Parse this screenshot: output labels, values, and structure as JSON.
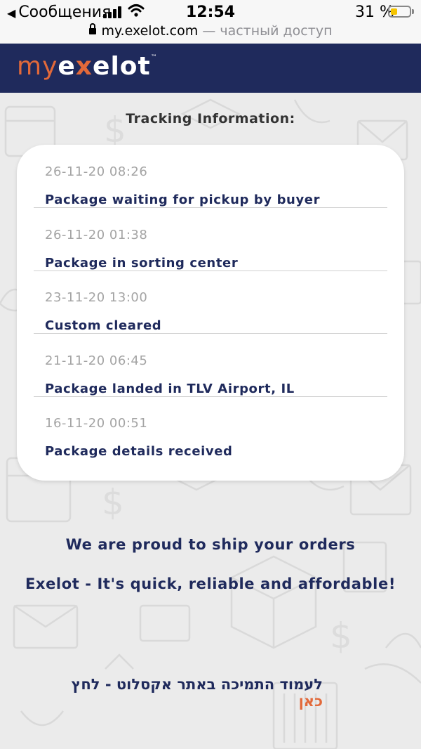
{
  "status_bar": {
    "back_label": "Сообщения",
    "time": "12:54",
    "battery": "31 %",
    "battery_level": 0.31
  },
  "url_bar": {
    "domain": "my.exelot.com",
    "suffix": "— частный доступ"
  },
  "header": {
    "logo": {
      "my": "my",
      "e": "e",
      "x": "x",
      "elot": "elot",
      "tm": "™"
    }
  },
  "tracking": {
    "title": "Tracking Information:",
    "events": [
      {
        "date": "26-11-20 08:26",
        "status": "Package waiting for pickup by buyer"
      },
      {
        "date": "26-11-20 01:38",
        "status": "Package in sorting center"
      },
      {
        "date": "23-11-20 13:00",
        "status": "Custom cleared"
      },
      {
        "date": "21-11-20 06:45",
        "status": "Package landed in TLV Airport, IL"
      },
      {
        "date": "16-11-20 00:51",
        "status": "Package details received"
      }
    ]
  },
  "promo": {
    "line1": "We are proud to ship your orders",
    "line2": "Exelot - It's quick, reliable and affordable!"
  },
  "support": {
    "text": "לעמוד התמיכה באתר אקסלוט - לחץ ",
    "link": "כאן"
  },
  "colors": {
    "navy": "#1f2a5c",
    "accent": "#e2693a",
    "background": "#ebebeb"
  }
}
